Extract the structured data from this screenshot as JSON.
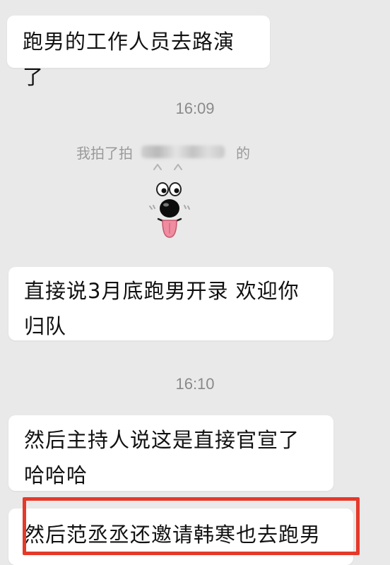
{
  "messages": [
    {
      "text": "跑男的工作人员去路演了"
    },
    {
      "text": "直接说3月底跑男开录 欢迎你归队"
    },
    {
      "text": "然后主持人说这是直接官宣了哈哈哈"
    },
    {
      "text": "然后范丞丞还邀请韩寒也去跑男"
    }
  ],
  "timestamps": [
    "16:09",
    "16:10"
  ],
  "pat_notice": {
    "prefix": "我拍了拍",
    "suffix": "的"
  },
  "sticker": {
    "icon": "cartoon-dog-face-icon",
    "eyes_caption": "^ ^"
  },
  "highlight": {
    "color": "#e5392a"
  }
}
